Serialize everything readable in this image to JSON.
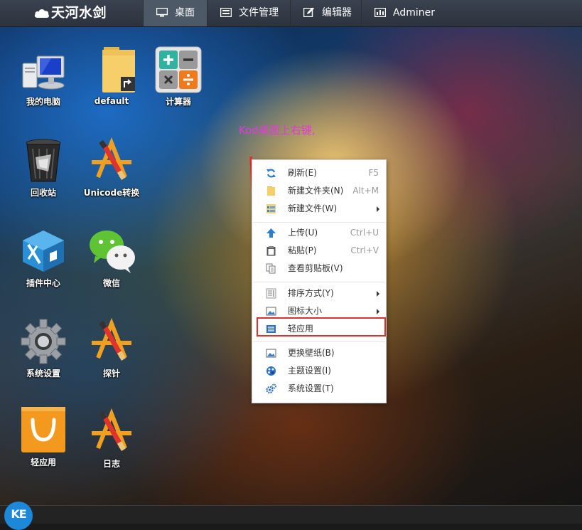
{
  "app": {
    "title": "天河水剑"
  },
  "nav": {
    "tabs": [
      {
        "label": "桌面",
        "icon": "monitor-icon",
        "active": true
      },
      {
        "label": "文件管理",
        "icon": "folder-list-icon",
        "active": false
      },
      {
        "label": "编辑器",
        "icon": "edit-icon",
        "active": false
      },
      {
        "label": "Adminer",
        "icon": "chart-icon",
        "active": false
      }
    ]
  },
  "desktop": {
    "icons": [
      {
        "label": "我的电脑",
        "icon": "computer-icon"
      },
      {
        "label": "default",
        "icon": "folder-shortcut-icon"
      },
      {
        "label": "计算器",
        "icon": "calculator-icon"
      },
      {
        "label": "回收站",
        "icon": "recycle-bin-icon"
      },
      {
        "label": "Unicode转换",
        "icon": "app-store-icon"
      },
      {
        "label": "插件中心",
        "icon": "plugin-center-icon"
      },
      {
        "label": "微信",
        "icon": "wechat-icon"
      },
      {
        "label": "系统设置",
        "icon": "gear-icon"
      },
      {
        "label": "探针",
        "icon": "app-store-icon"
      },
      {
        "label": "轻应用",
        "icon": "shopping-bag-icon"
      },
      {
        "label": "日志",
        "icon": "app-store-icon"
      }
    ],
    "annotation": "Kod桌面上右键,"
  },
  "context_menu": {
    "items": [
      {
        "label": "刷新(E)",
        "shortcut": "F5",
        "icon": "refresh-icon"
      },
      {
        "label": "新建文件夹(N)",
        "shortcut": "Alt+M",
        "icon": "folder-icon"
      },
      {
        "label": "新建文件(W)",
        "submenu": true,
        "icon": "new-file-icon"
      },
      {
        "label": "上传(U)",
        "shortcut": "Ctrl+U",
        "icon": "upload-icon"
      },
      {
        "label": "粘贴(P)",
        "shortcut": "Ctrl+V",
        "icon": "paste-icon"
      },
      {
        "label": "查看剪贴板(V)",
        "icon": "clipboard-icon"
      },
      {
        "label": "排序方式(Y)",
        "submenu": true,
        "icon": "sort-icon"
      },
      {
        "label": "图标大小",
        "submenu": true,
        "icon": "icon-size-icon"
      },
      {
        "label": "轻应用",
        "icon": "light-app-icon",
        "highlighted": true
      },
      {
        "label": "更换壁纸(B)",
        "icon": "wallpaper-icon"
      },
      {
        "label": "主题设置(I)",
        "icon": "theme-icon"
      },
      {
        "label": "系统设置(T)",
        "icon": "settings-icon"
      }
    ]
  },
  "taskbar": {
    "start_label": "KE"
  },
  "colors": {
    "accent": "#1d87d8",
    "highlight_border": "#e0302e",
    "annotation": "#e43ad9",
    "topbar": "#2d333d"
  }
}
